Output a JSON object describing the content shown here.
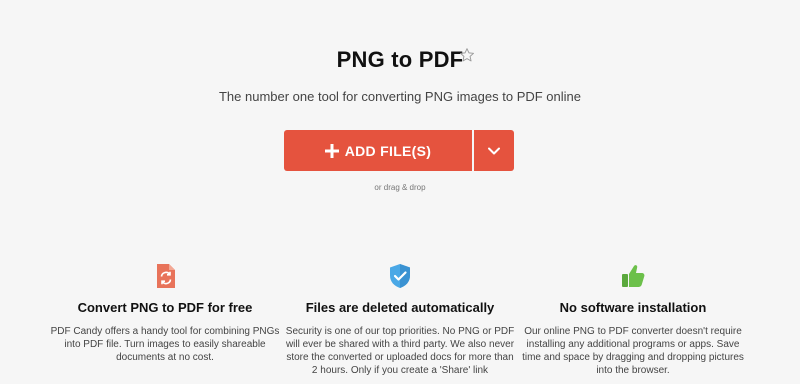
{
  "header": {
    "title": "PNG to PDF",
    "subtitle": "The number one tool for converting PNG images to PDF online"
  },
  "upload": {
    "add_files_label": "ADD FILE(S)",
    "drag_hint": "or drag & drop",
    "button_color": "#e5533e"
  },
  "features": [
    {
      "icon": "convert-refresh-icon",
      "icon_color": "#e8735a",
      "title": "Convert PNG to PDF for free",
      "description": "PDF Candy offers a handy tool for combining PNGs into PDF file. Turn images to easily shareable documents at no cost."
    },
    {
      "icon": "shield-check-icon",
      "icon_color": "#4aa8e6",
      "title": "Files are deleted automatically",
      "description": "Security is one of our top priorities. No PNG or PDF will ever be shared with a third party. We also never store the converted or uploaded docs for more than 2 hours. Only if you create a 'Share' link"
    },
    {
      "icon": "thumbs-up-icon",
      "icon_color": "#6cc04a",
      "title": "No software installation",
      "description": "Our online PNG to PDF converter doesn't require installing any additional programs or apps. Save time and space by dragging and dropping pictures into the browser."
    }
  ]
}
